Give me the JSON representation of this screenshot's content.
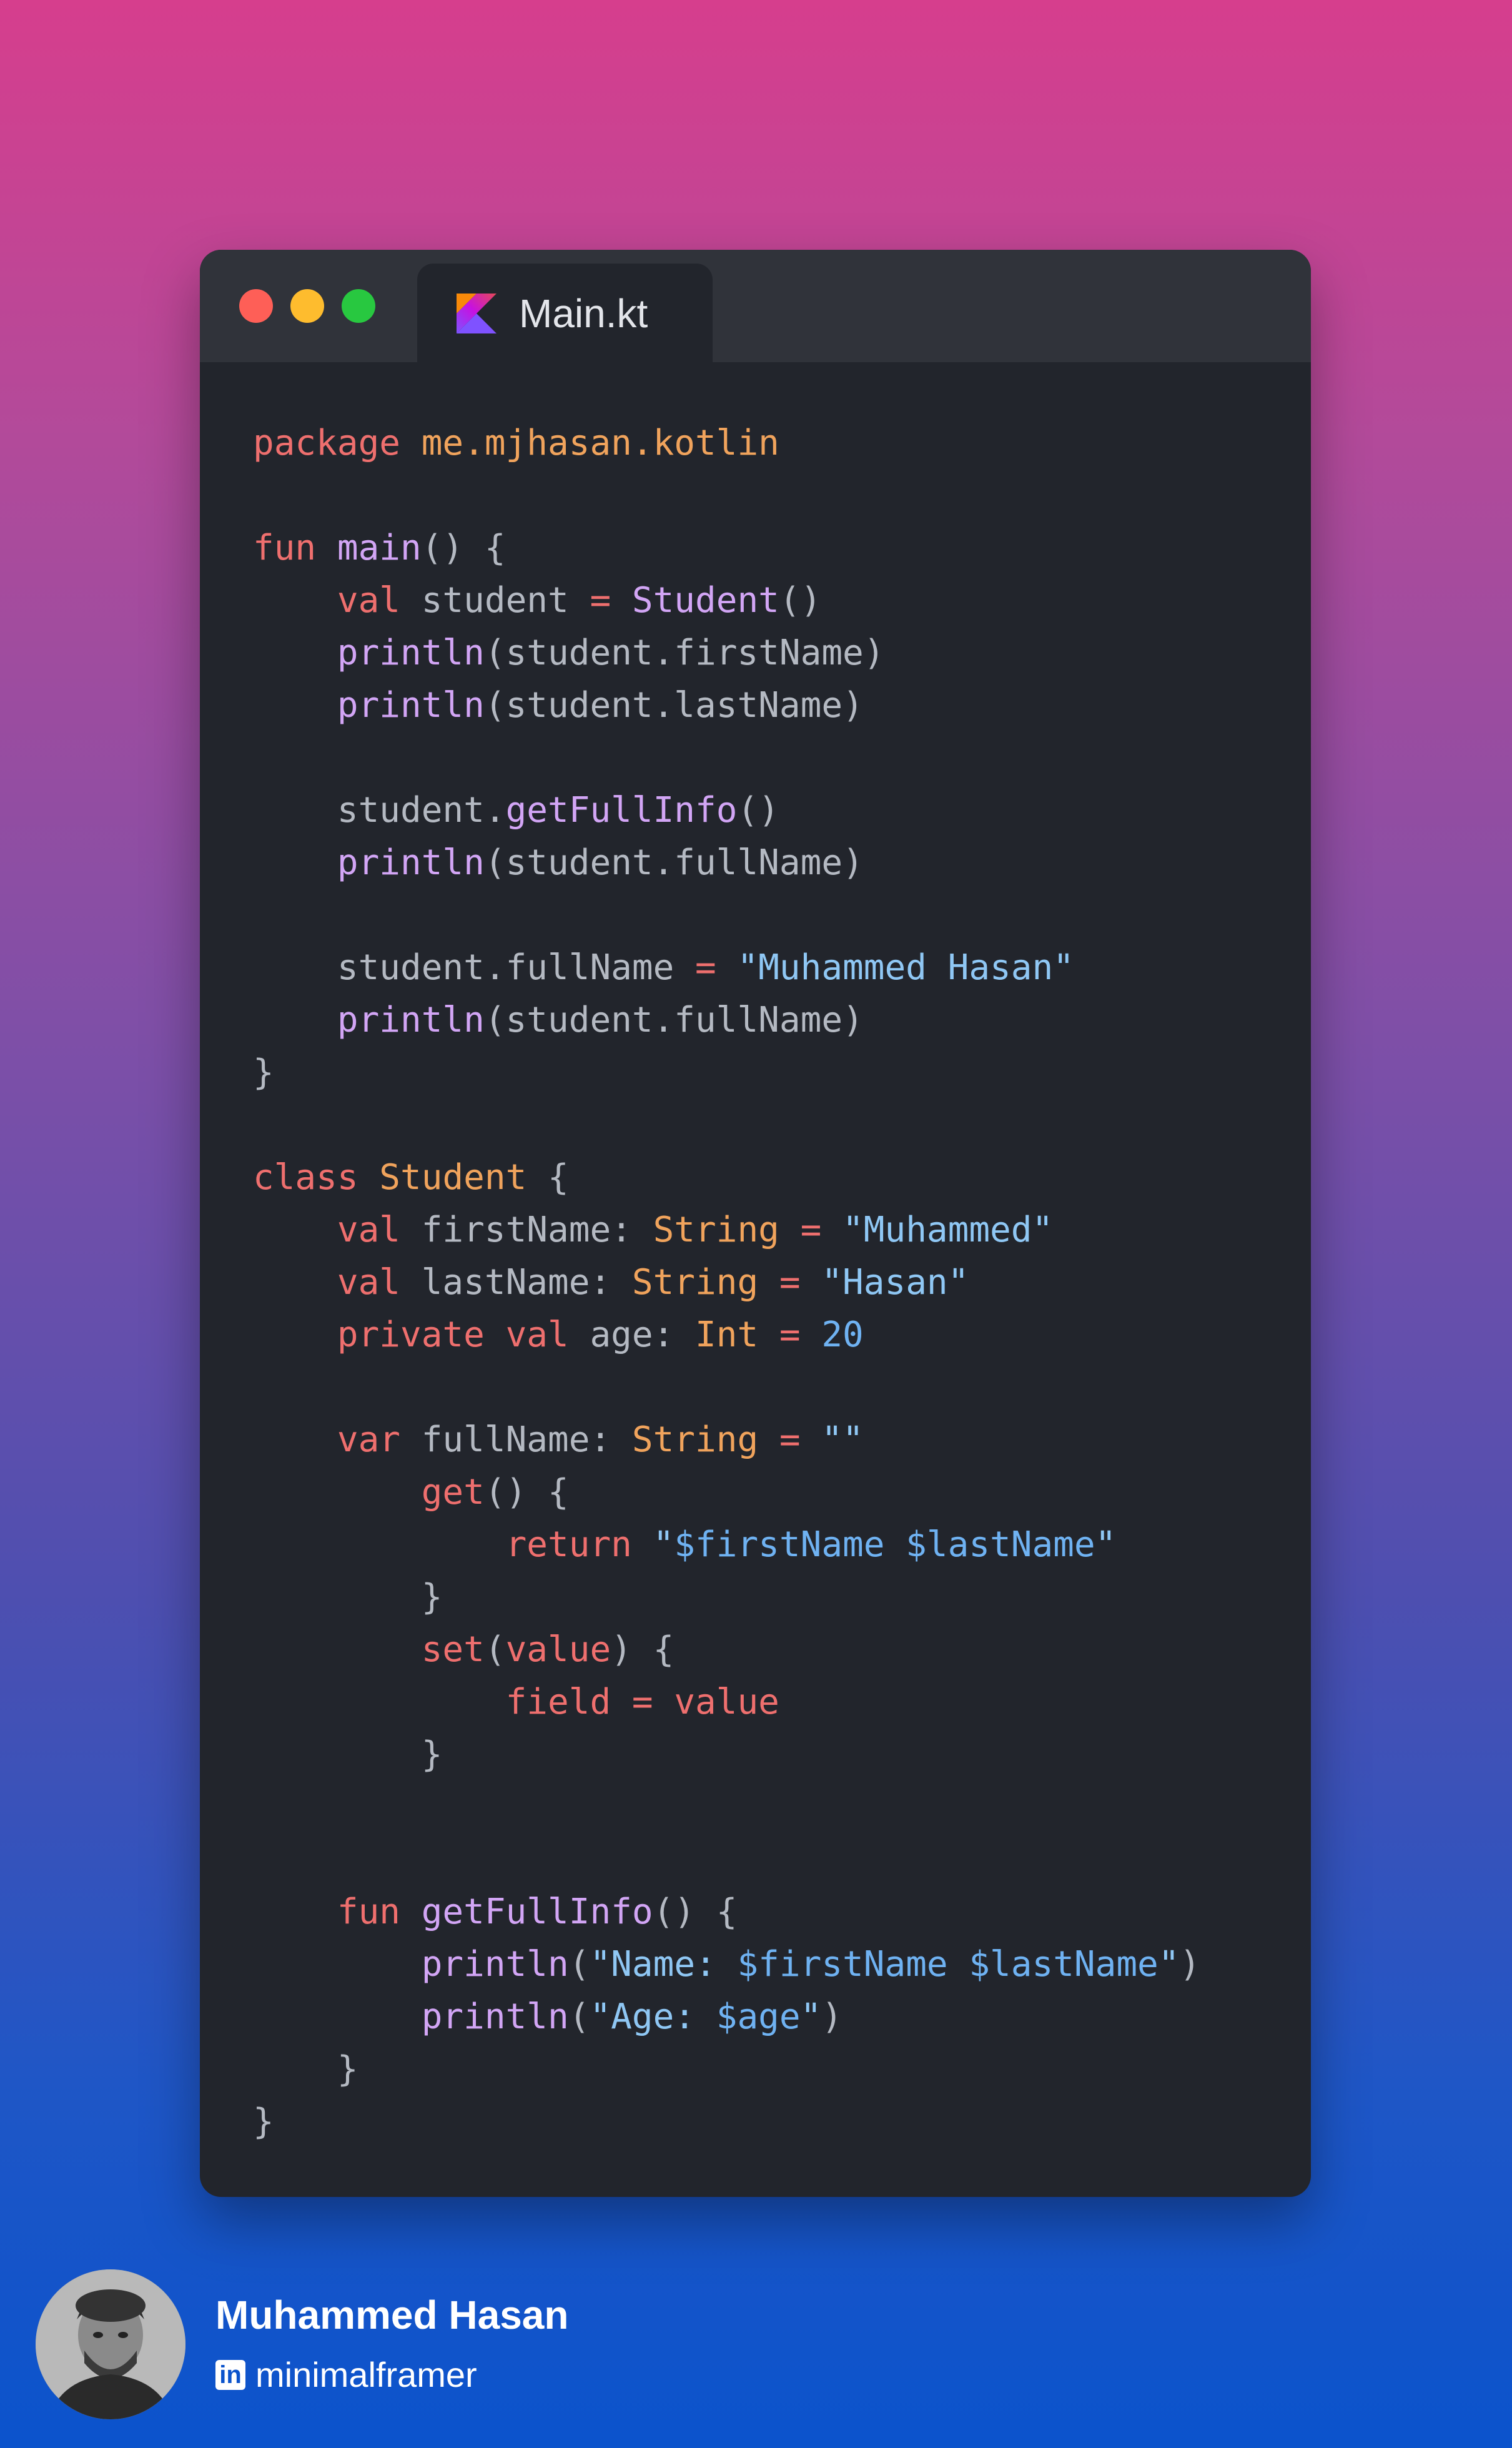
{
  "colors": {
    "background_top": "#d63e8d",
    "background_bottom": "#0b53cc",
    "window": "#22252c",
    "titlebar": "#30333a",
    "traffic_red": "#fe5f57",
    "traffic_yellow": "#febc2e",
    "traffic_green": "#28c840"
  },
  "window": {
    "tab_title": "Main.kt",
    "tab_icon": "kotlin-logo-icon"
  },
  "code_lines": [
    [
      {
        "t": "package ",
        "c": "kw"
      },
      {
        "t": "me.mjhasan.kotlin",
        "c": "pk"
      }
    ],
    [],
    [
      {
        "t": "fun ",
        "c": "kw"
      },
      {
        "t": "main",
        "c": "fn"
      },
      {
        "t": "() {",
        "c": ""
      }
    ],
    [
      {
        "t": "    val ",
        "c": "kw"
      },
      {
        "t": "student ",
        "c": ""
      },
      {
        "t": "= ",
        "c": "kw"
      },
      {
        "t": "Student",
        "c": "fn"
      },
      {
        "t": "()",
        "c": ""
      }
    ],
    [
      {
        "t": "    println",
        "c": "fn"
      },
      {
        "t": "(student.firstName)",
        "c": ""
      }
    ],
    [
      {
        "t": "    println",
        "c": "fn"
      },
      {
        "t": "(student.lastName)",
        "c": ""
      }
    ],
    [],
    [
      {
        "t": "    student.",
        "c": ""
      },
      {
        "t": "getFullInfo",
        "c": "fn"
      },
      {
        "t": "()",
        "c": ""
      }
    ],
    [
      {
        "t": "    println",
        "c": "fn"
      },
      {
        "t": "(student.fullName)",
        "c": ""
      }
    ],
    [],
    [
      {
        "t": "    student.fullName ",
        "c": ""
      },
      {
        "t": "= ",
        "c": "kw"
      },
      {
        "t": "\"Muhammed Hasan\"",
        "c": "st"
      }
    ],
    [
      {
        "t": "    println",
        "c": "fn"
      },
      {
        "t": "(student.fullName)",
        "c": ""
      }
    ],
    [
      {
        "t": "}",
        "c": ""
      }
    ],
    [],
    [
      {
        "t": "class ",
        "c": "kw"
      },
      {
        "t": "Student ",
        "c": "ty"
      },
      {
        "t": "{",
        "c": ""
      }
    ],
    [
      {
        "t": "    val ",
        "c": "kw"
      },
      {
        "t": "firstName: ",
        "c": ""
      },
      {
        "t": "String ",
        "c": "ty"
      },
      {
        "t": "= ",
        "c": "kw"
      },
      {
        "t": "\"Muhammed\"",
        "c": "st"
      }
    ],
    [
      {
        "t": "    val ",
        "c": "kw"
      },
      {
        "t": "lastName: ",
        "c": ""
      },
      {
        "t": "String ",
        "c": "ty"
      },
      {
        "t": "= ",
        "c": "kw"
      },
      {
        "t": "\"Hasan\"",
        "c": "st"
      }
    ],
    [
      {
        "t": "    private val ",
        "c": "kw"
      },
      {
        "t": "age: ",
        "c": ""
      },
      {
        "t": "Int ",
        "c": "ty"
      },
      {
        "t": "= ",
        "c": "kw"
      },
      {
        "t": "20",
        "c": "nm"
      }
    ],
    [],
    [
      {
        "t": "    var ",
        "c": "kw"
      },
      {
        "t": "fullName: ",
        "c": ""
      },
      {
        "t": "String ",
        "c": "ty"
      },
      {
        "t": "= ",
        "c": "kw"
      },
      {
        "t": "\"\"",
        "c": "st"
      }
    ],
    [
      {
        "t": "        get",
        "c": "kw"
      },
      {
        "t": "() {",
        "c": ""
      }
    ],
    [
      {
        "t": "            return ",
        "c": "kw"
      },
      {
        "t": "\"",
        "c": "st"
      },
      {
        "t": "$firstName $lastName",
        "c": "nm"
      },
      {
        "t": "\"",
        "c": "st"
      }
    ],
    [
      {
        "t": "        }",
        "c": ""
      }
    ],
    [
      {
        "t": "        set",
        "c": "kw"
      },
      {
        "t": "(",
        "c": ""
      },
      {
        "t": "value",
        "c": "kw"
      },
      {
        "t": ") {",
        "c": ""
      }
    ],
    [
      {
        "t": "            field ",
        "c": "kw"
      },
      {
        "t": "= ",
        "c": "kw"
      },
      {
        "t": "value",
        "c": "kw"
      }
    ],
    [
      {
        "t": "        }",
        "c": ""
      }
    ],
    [],
    [],
    [
      {
        "t": "    fun ",
        "c": "kw"
      },
      {
        "t": "getFullInfo",
        "c": "fn"
      },
      {
        "t": "() {",
        "c": ""
      }
    ],
    [
      {
        "t": "        println",
        "c": "fn"
      },
      {
        "t": "(",
        "c": ""
      },
      {
        "t": "\"Name: ",
        "c": "st"
      },
      {
        "t": "$firstName $lastName",
        "c": "nm"
      },
      {
        "t": "\"",
        "c": "st"
      },
      {
        "t": ")",
        "c": ""
      }
    ],
    [
      {
        "t": "        println",
        "c": "fn"
      },
      {
        "t": "(",
        "c": ""
      },
      {
        "t": "\"Age: ",
        "c": "st"
      },
      {
        "t": "$age",
        "c": "nm"
      },
      {
        "t": "\"",
        "c": "st"
      },
      {
        "t": ")",
        "c": ""
      }
    ],
    [
      {
        "t": "    }",
        "c": ""
      }
    ],
    [
      {
        "t": "}",
        "c": ""
      }
    ]
  ],
  "footer": {
    "name": "Muhammed Hasan",
    "handle": "minimalframer",
    "social_icon": "linkedin-icon",
    "social_icon_text": "in"
  }
}
